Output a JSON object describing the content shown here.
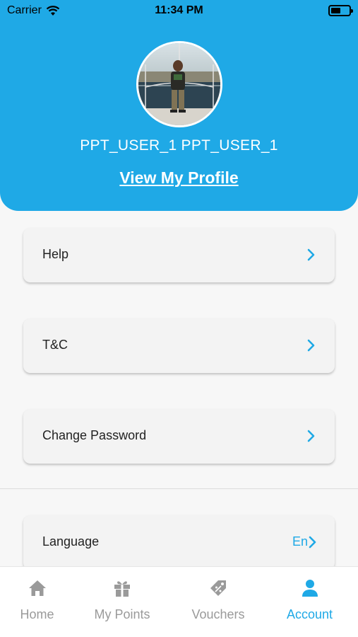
{
  "status_bar": {
    "carrier": "Carrier",
    "time": "11:34 PM",
    "battery_level": 0.55
  },
  "profile": {
    "name": "PPT_USER_1 PPT_USER_1",
    "view_profile_label": "View My Profile"
  },
  "menu": {
    "help": "Help",
    "tnc": "T&C",
    "change_password": "Change Password",
    "language": "Language",
    "language_value": "En"
  },
  "tabs": {
    "home": "Home",
    "my_points": "My Points",
    "vouchers": "Vouchers",
    "account": "Account"
  },
  "colors": {
    "accent": "#1fa9e6",
    "inactive": "#9a9a9a",
    "background": "#f7f7f7"
  },
  "icons": [
    "wifi-icon",
    "chevron-right-icon",
    "home-icon",
    "gift-icon",
    "tag-icon",
    "person-icon"
  ]
}
